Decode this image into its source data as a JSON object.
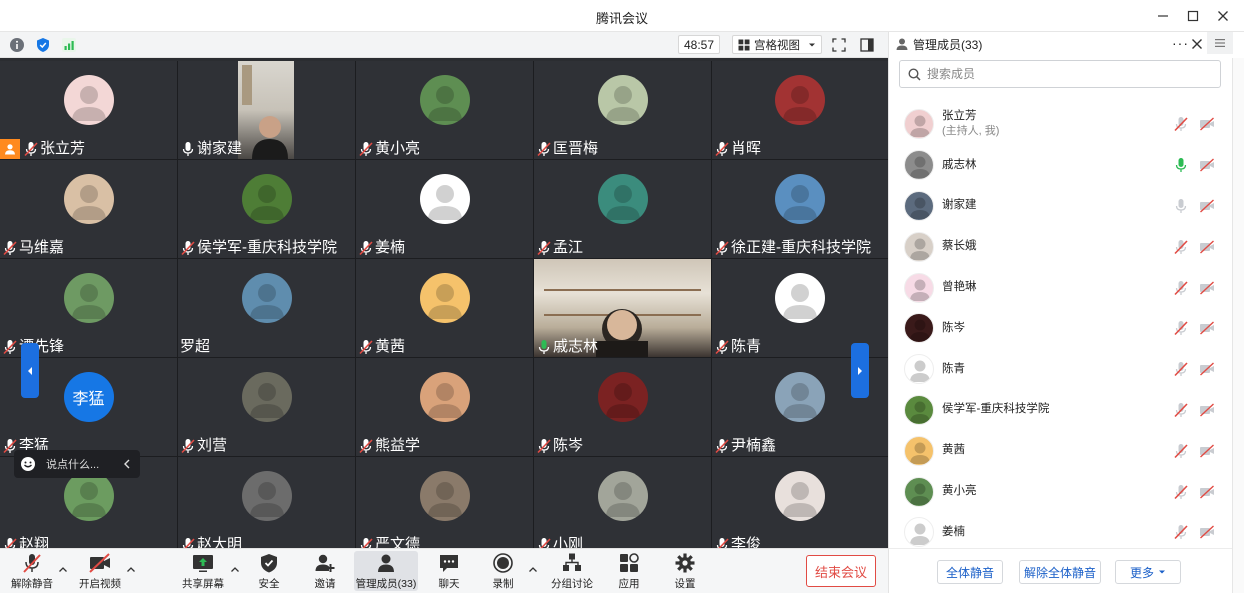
{
  "window": {
    "title": "腾讯会议"
  },
  "topbar": {
    "timer": "48:57",
    "view_label": "宫格视图"
  },
  "colors": {
    "accent": "#1677e5",
    "end": "#e14b44",
    "speaking": "#2dbb54",
    "host_badge": "#ff8a1f"
  },
  "grid": {
    "tiles": [
      {
        "name": "张立芳",
        "host": true,
        "mic": "muted",
        "avatar": "#f3d7d6"
      },
      {
        "name": "谢家建",
        "host": false,
        "mic": "on",
        "video": true
      },
      {
        "name": "黄小亮",
        "host": false,
        "mic": "muted",
        "avatar": "#5e8e52"
      },
      {
        "name": "匡晋梅",
        "host": false,
        "mic": "muted",
        "avatar": "#b9c7a7"
      },
      {
        "name": "肖晖",
        "host": false,
        "mic": "muted",
        "avatar": "#a23333"
      },
      {
        "name": "马维嘉",
        "host": false,
        "mic": "muted",
        "avatar": "#d9c0a5"
      },
      {
        "name": "侯学军-重庆科技学院",
        "host": false,
        "mic": "muted",
        "avatar": "#4e7d36"
      },
      {
        "name": "姜楠",
        "host": false,
        "mic": "muted",
        "avatar": "#ffffff"
      },
      {
        "name": "孟江",
        "host": false,
        "mic": "muted",
        "avatar": "#3b8c7d"
      },
      {
        "name": "徐正建-重庆科技学院",
        "host": false,
        "mic": "muted",
        "avatar": "#5a8fc0"
      },
      {
        "name": "谭先锋",
        "host": false,
        "mic": "muted",
        "avatar": "#6e9a63"
      },
      {
        "name": "罗超",
        "host": false,
        "mic": "none",
        "avatar": "#5f8dae"
      },
      {
        "name": "黄茜",
        "host": false,
        "mic": "muted",
        "avatar": "#f5c26b"
      },
      {
        "name": "戚志林",
        "host": false,
        "mic": "speaking",
        "video": true
      },
      {
        "name": "陈青",
        "host": false,
        "mic": "muted",
        "avatar": "#ffffff"
      },
      {
        "name": "李猛",
        "host": false,
        "mic": "muted",
        "avatar_text": "李猛"
      },
      {
        "name": "刘营",
        "host": false,
        "mic": "muted",
        "avatar": "#6a6a5e"
      },
      {
        "name": "熊益学",
        "host": false,
        "mic": "muted",
        "avatar": "#d9a27a"
      },
      {
        "name": "陈岑",
        "host": false,
        "mic": "muted",
        "avatar": "#7b2222"
      },
      {
        "name": "尹楠鑫",
        "host": false,
        "mic": "muted",
        "avatar": "#8aa3b8"
      },
      {
        "name": "赵翔",
        "host": false,
        "mic": "muted",
        "avatar": "#6c9c60"
      },
      {
        "name": "赵大明",
        "host": false,
        "mic": "muted",
        "avatar": "#6c6c6c"
      },
      {
        "name": "严文德",
        "host": false,
        "mic": "muted",
        "avatar": "#8a7a6a"
      },
      {
        "name": "小刚",
        "host": false,
        "mic": "muted",
        "avatar": "#a2a59a"
      },
      {
        "name": "李俊",
        "host": false,
        "mic": "muted",
        "avatar": "#e8e0dc"
      }
    ],
    "chat_placeholder": "说点什么..."
  },
  "toolbar": {
    "unmute": "解除静音",
    "start_video": "开启视频",
    "share": "共享屏幕",
    "security": "安全",
    "invite": "邀请",
    "members": "管理成员(33)",
    "chat": "聊天",
    "record": "录制",
    "breakout": "分组讨论",
    "apps": "应用",
    "settings": "设置",
    "end": "结束会议"
  },
  "panel": {
    "title": "管理成员(33)",
    "search_placeholder": "搜索成员",
    "members": [
      {
        "name": "张立芳",
        "role": "(主持人, 我)",
        "mic": "muted",
        "avatar": "#f0cfd0"
      },
      {
        "name": "戚志林",
        "role": "",
        "mic": "speaking",
        "avatar": "#8c8c8c"
      },
      {
        "name": "谢家建",
        "role": "",
        "mic": "on",
        "avatar": "#5c6b7e"
      },
      {
        "name": "蔡长娥",
        "role": "",
        "mic": "muted",
        "avatar": "#d8d0c8"
      },
      {
        "name": "曾艳琳",
        "role": "",
        "mic": "muted",
        "avatar": "#f7dbe6"
      },
      {
        "name": "陈岑",
        "role": "",
        "mic": "muted",
        "avatar": "#3a1a1a"
      },
      {
        "name": "陈青",
        "role": "",
        "mic": "muted",
        "avatar": "#ffffff"
      },
      {
        "name": "侯学军-重庆科技学院",
        "role": "",
        "mic": "muted",
        "avatar": "#5a8a3e"
      },
      {
        "name": "黄茜",
        "role": "",
        "mic": "muted",
        "avatar": "#f5c26b"
      },
      {
        "name": "黄小亮",
        "role": "",
        "mic": "muted",
        "avatar": "#5e8e52"
      },
      {
        "name": "姜楠",
        "role": "",
        "mic": "muted",
        "avatar": "#ffffff"
      }
    ],
    "mute_all": "全体静音",
    "unmute_all": "解除全体静音",
    "more": "更多"
  }
}
